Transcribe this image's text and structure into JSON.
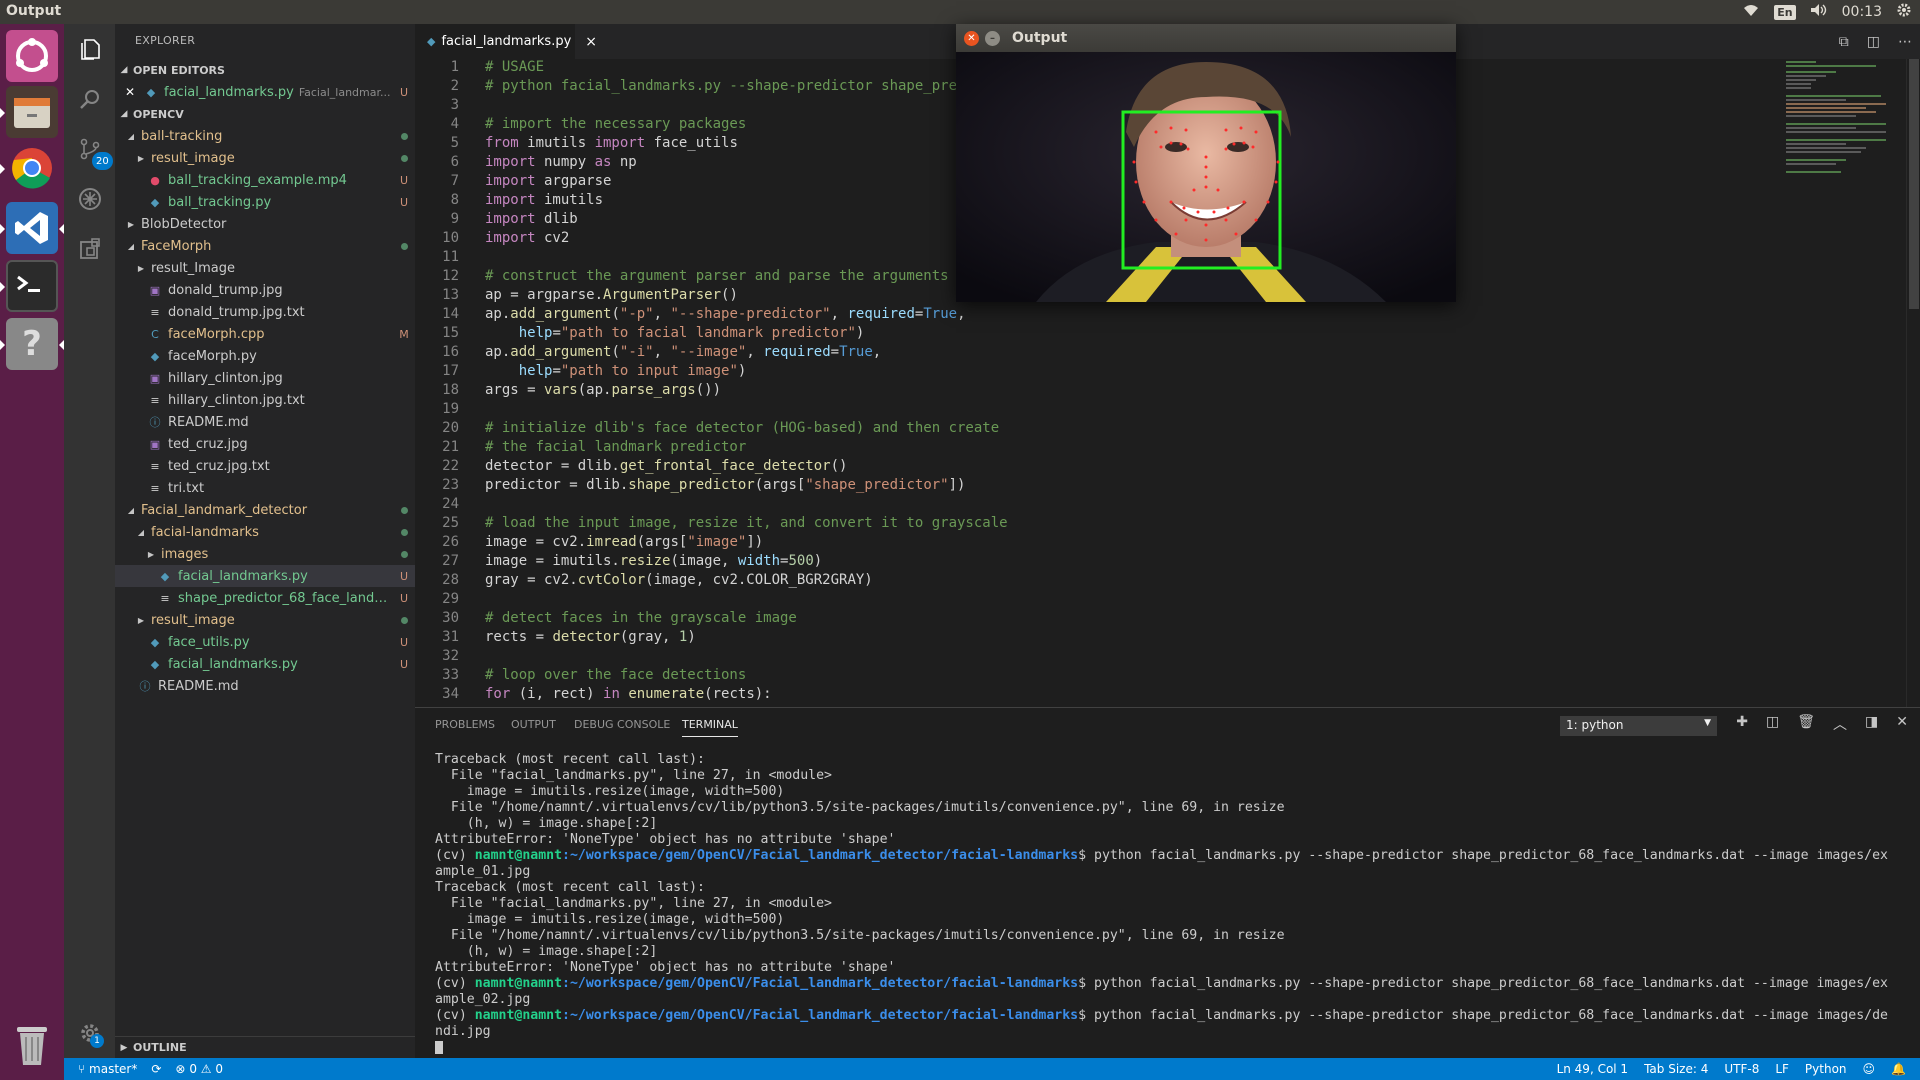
{
  "topbar": {
    "title": "Output",
    "lang": "En",
    "time": "00:13"
  },
  "sidebar": {
    "title": "EXPLORER",
    "open_editors_label": "OPEN EDITORS",
    "open_editor": {
      "name": "facial_landmarks.py",
      "desc": "Facial_landmar...",
      "status": "U"
    },
    "project_label": "OPENCV",
    "tree": [
      {
        "name": "ball-tracking",
        "status": "dot",
        "twisty": "open"
      },
      {
        "name": "result_image",
        "status": "dot",
        "twisty": "closed"
      },
      {
        "name": "ball_tracking_example.mp4",
        "status": "U",
        "icon": "video"
      },
      {
        "name": "ball_tracking.py",
        "status": "U",
        "icon": "python"
      },
      {
        "name": "BlobDetector",
        "status": "",
        "twisty": "closed"
      },
      {
        "name": "FaceMorph",
        "status": "dot",
        "twisty": "open"
      },
      {
        "name": "result_Image",
        "status": "",
        "twisty": "closed"
      },
      {
        "name": "donald_trump.jpg",
        "status": "",
        "icon": "image"
      },
      {
        "name": "donald_trump.jpg.txt",
        "status": "",
        "icon": "text"
      },
      {
        "name": "faceMorph.cpp",
        "status": "M",
        "icon": "cpp"
      },
      {
        "name": "faceMorph.py",
        "status": "",
        "icon": "python"
      },
      {
        "name": "hillary_clinton.jpg",
        "status": "",
        "icon": "image"
      },
      {
        "name": "hillary_clinton.jpg.txt",
        "status": "",
        "icon": "text"
      },
      {
        "name": "README.md",
        "status": "",
        "icon": "info"
      },
      {
        "name": "ted_cruz.jpg",
        "status": "",
        "icon": "image"
      },
      {
        "name": "ted_cruz.jpg.txt",
        "status": "",
        "icon": "text"
      },
      {
        "name": "tri.txt",
        "status": "",
        "icon": "text"
      },
      {
        "name": "Facial_landmark_detector",
        "status": "dot",
        "twisty": "open"
      },
      {
        "name": "facial-landmarks",
        "status": "dot",
        "twisty": "open"
      },
      {
        "name": "images",
        "status": "dot",
        "twisty": "closed"
      },
      {
        "name": "facial_landmarks.py",
        "status": "U",
        "icon": "python",
        "selected": true
      },
      {
        "name": "shape_predictor_68_face_landmar...",
        "status": "U",
        "icon": "text"
      },
      {
        "name": "result_image",
        "status": "dot",
        "twisty": "closed"
      },
      {
        "name": "face_utils.py",
        "status": "U",
        "icon": "python"
      },
      {
        "name": "facial_landmarks.py",
        "status": "U",
        "icon": "python"
      },
      {
        "name": "README.md",
        "status": "",
        "icon": "info"
      }
    ],
    "outline_label": "OUTLINE"
  },
  "activity": {
    "scm_badge": "20",
    "settings_badge": "1"
  },
  "editor": {
    "tab_label": "facial_landmarks.py",
    "close": "×",
    "line_numbers": [
      "1",
      "2",
      "3",
      "4",
      "5",
      "6",
      "7",
      "8",
      "9",
      "10",
      "11",
      "12",
      "13",
      "14",
      "15",
      "16",
      "17",
      "18",
      "19",
      "20",
      "21",
      "22",
      "23",
      "24",
      "25",
      "26",
      "27",
      "28",
      "29",
      "30",
      "31",
      "32",
      "33",
      "34"
    ]
  },
  "output_window": {
    "title": "Output"
  },
  "panel": {
    "tabs": [
      "PROBLEMS",
      "OUTPUT",
      "DEBUG CONSOLE",
      "TERMINAL"
    ],
    "terminal_select": "1: python",
    "prompt_user": "namnt@namnt",
    "prompt_path": ":~/workspace/gem/OpenCV/Facial_landmark_detector/facial-landmarks"
  },
  "status": {
    "branch": "master*",
    "errors": "0",
    "warnings": "0",
    "position": "Ln 49, Col 1",
    "tab_size": "Tab Size: 4",
    "encoding": "UTF-8",
    "eol": "LF",
    "language": "Python"
  }
}
